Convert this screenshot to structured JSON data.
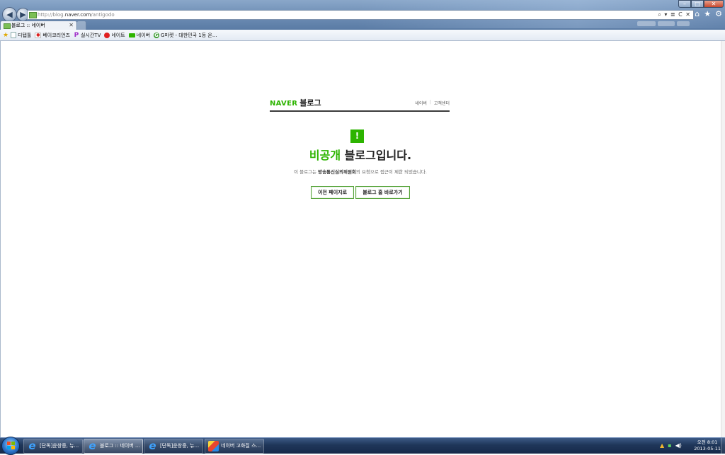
{
  "browser": {
    "url_prefix": "http://blog.",
    "url_domain": "naver.com",
    "url_path": "/antigodo",
    "address_tools": "⌕ ▾ ≣ C ✕",
    "tab_title": "블로그 :: 네이버",
    "tab_close": "✕",
    "window_min": "–",
    "window_max": "□",
    "window_close": "✕",
    "back": "◀",
    "forward": "▶",
    "home_icon": "⌂",
    "favorites_icon": "★",
    "tools_icon": "⚙"
  },
  "favorites": [
    {
      "label": "디탭툴",
      "icon": "page-icon"
    },
    {
      "label": "베이코리언즈",
      "icon": "flag-icon"
    },
    {
      "label": "실시간TV",
      "icon": "p-icon"
    },
    {
      "label": "네이트",
      "icon": "nate-icon"
    },
    {
      "label": "네이버",
      "icon": "naver-icon"
    },
    {
      "label": "G마켓 - 대한민국 1등 온...",
      "icon": "gmarket-icon"
    }
  ],
  "blog": {
    "logo_naver": "NAVER",
    "logo_blog": "블로그",
    "link_naver": "네이버",
    "link_sep": "|",
    "link_support": "고객센터",
    "alert_symbol": "!",
    "headline_green": "비공개",
    "headline_rest": " 블로그입니다.",
    "desc_prefix": "이 블로그는 ",
    "desc_bold": "방송통신심의위원회",
    "desc_suffix": "의 요청으로 접근이 제한 되었습니다.",
    "btn_prev": "이전 페이지로",
    "btn_home": "블로그 홈 바로가기"
  },
  "taskbar": {
    "tasks": [
      {
        "label": "[단독]윤창중, 뉴...",
        "app": "internet-explorer",
        "active": false
      },
      {
        "label": "블로그 :: 네이버 ...",
        "app": "internet-explorer",
        "active": true
      },
      {
        "label": "[단독]윤창중, 뉴...",
        "app": "internet-explorer",
        "active": false
      },
      {
        "label": "네이버 고화질 스...",
        "app": "chrome",
        "active": false
      }
    ],
    "clock_time": "오전 8:01",
    "clock_date": "2013-05-11"
  },
  "colors": {
    "naver_green": "#2db400",
    "taskbar": "#1f3659"
  }
}
